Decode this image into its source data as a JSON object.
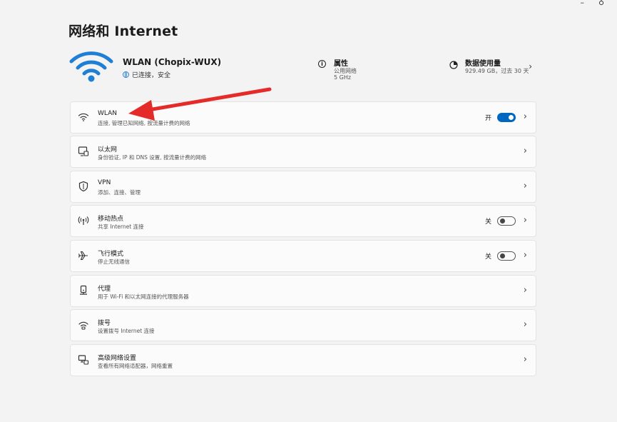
{
  "window": {
    "minimize_glyph": "–",
    "close_glyph": "♁"
  },
  "page": {
    "title": "网络和 Internet"
  },
  "hero": {
    "network_name": "WLAN (Chopix-WUX)",
    "status": "已连接，安全",
    "properties": {
      "title": "属性",
      "line1": "公用网络",
      "line2": "5 GHz"
    },
    "data_usage": {
      "title": "数据使用量",
      "detail": "929.49 GB，过去 30 天"
    }
  },
  "items": [
    {
      "title": "WLAN",
      "subtitle": "连接, 管理已知网络, 按流量计费的网络",
      "icon": "wifi-icon",
      "toggle": {
        "label": "开",
        "on": true
      }
    },
    {
      "title": "以太网",
      "subtitle": "身份验证, IP 和 DNS 设置, 按流量计费的网络",
      "icon": "ethernet-icon"
    },
    {
      "title": "VPN",
      "subtitle": "添加、连接、管理",
      "icon": "shield-icon"
    },
    {
      "title": "移动热点",
      "subtitle": "共享 Internet 连接",
      "icon": "hotspot-icon",
      "toggle": {
        "label": "关",
        "on": false
      }
    },
    {
      "title": "飞行模式",
      "subtitle": "停止无线通信",
      "icon": "airplane-icon",
      "toggle": {
        "label": "关",
        "on": false
      }
    },
    {
      "title": "代理",
      "subtitle": "用于 Wi-Fi 和以太网连接的代理服务器",
      "icon": "proxy-icon"
    },
    {
      "title": "拨号",
      "subtitle": "设置拨号 Internet 连接",
      "icon": "dialup-icon"
    },
    {
      "title": "高级网络设置",
      "subtitle": "查看所有网络适配器，网络重置",
      "icon": "advanced-network-icon"
    }
  ],
  "colors": {
    "accent": "#0067c0",
    "hero_wifi": "#1f7fd4",
    "annotation_arrow": "#e52a2a"
  }
}
